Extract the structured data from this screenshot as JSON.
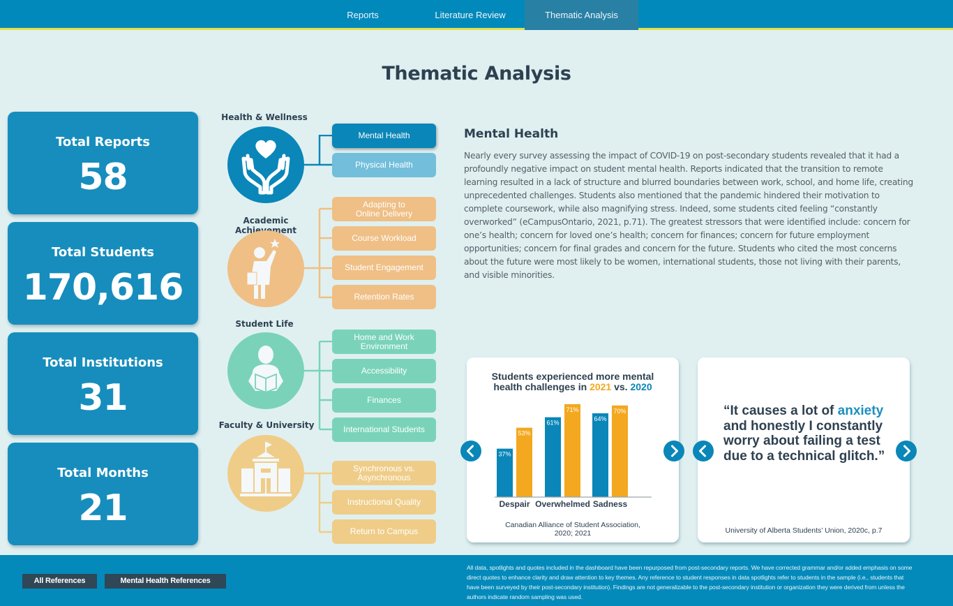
{
  "nav": {
    "tabs": [
      {
        "label": "Reports",
        "active": false
      },
      {
        "label": "Literature Review",
        "active": false
      },
      {
        "label": "Thematic Analysis",
        "active": true
      }
    ]
  },
  "page_title": "Thematic Analysis",
  "kpis": [
    {
      "label": "Total Reports",
      "value": "58"
    },
    {
      "label": "Total Students",
      "value": "170,616"
    },
    {
      "label": "Total Institutions",
      "value": "31"
    },
    {
      "label": "Total Months",
      "value": "21"
    }
  ],
  "themes": [
    {
      "title": "Health & Wellness",
      "icon": "hands-heart-icon",
      "color": "#0a86b8",
      "items": [
        {
          "label": "Mental Health",
          "selected": true
        },
        {
          "label": "Physical Health",
          "selected": false
        }
      ]
    },
    {
      "title": "Academic Achievement",
      "icon": "student-reaching-star-icon",
      "color": "#efbf85",
      "items": [
        {
          "label": "Adapting to\nOnline Delivery"
        },
        {
          "label": "Course Workload"
        },
        {
          "label": "Student Engagement"
        },
        {
          "label": "Retention Rates"
        }
      ]
    },
    {
      "title": "Student Life",
      "icon": "person-reading-icon",
      "color": "#7ad3b9",
      "items": [
        {
          "label": "Home and Work\nEnvironment"
        },
        {
          "label": "Accessibility"
        },
        {
          "label": "Finances"
        },
        {
          "label": "International Students"
        }
      ]
    },
    {
      "title": "Faculty & University",
      "icon": "university-building-icon",
      "color": "#efcd88",
      "items": [
        {
          "label": "Synchronous vs.\nAsynchronous"
        },
        {
          "label": "Instructional Quality"
        },
        {
          "label": "Return to Campus"
        }
      ]
    }
  ],
  "detail": {
    "title": "Mental Health",
    "body": "Nearly every survey assessing the impact of COVID-19 on post-secondary students revealed that it had a profoundly negative impact on student mental health. Reports indicated that the transition to remote learning resulted in a lack of structure and blurred boundaries between work, school, and home life, creating unprecedented challenges. Students also mentioned that the pandemic hindered their motivation to complete coursework, while also magnifying stress. Indeed, some students cited feeling “constantly overworked” (eCampusOntario, 2021, p.71). The greatest stressors that were identified include: concern for one’s health; concern for loved one’s health; concern for finances; concern for future employment opportunities; concern for final grades and concern for the future. Students who cited the most concerns about the future were most likely to be women, international students, those not living with their parents, and visible minorities."
  },
  "chart_card": {
    "title_line1": "Students experienced more mental",
    "title_line2_pre": "health challenges in ",
    "title_year_a": "2021",
    "title_mid": " vs. ",
    "title_year_b": "2020",
    "source_line1": "Canadian Alliance of Student Association,",
    "source_line2": "2020; 2021"
  },
  "chart_data": {
    "type": "bar",
    "title": "Students experienced more mental health challenges in 2021 vs. 2020",
    "xlabel": "",
    "ylabel": "",
    "ylim": [
      0,
      80
    ],
    "grid": false,
    "categories": [
      "Despair",
      "Overwhelmed",
      "Sadness"
    ],
    "series": [
      {
        "name": "2020",
        "color": "#0a86b8",
        "values": [
          37,
          61,
          64
        ],
        "labels": [
          "37%",
          "61%",
          "64%"
        ]
      },
      {
        "name": "2021",
        "color": "#f3a81f",
        "values": [
          53,
          71,
          70
        ],
        "labels": [
          "53%",
          "71%",
          "70%"
        ]
      }
    ]
  },
  "quote_card": {
    "quote_pre": "“It causes a lot of ",
    "quote_highlight": "anxiety",
    "quote_post": " and honestly I constantly worry about failing a test due to a technical glitch.”",
    "source": "University of Alberta Students’ Union, 2020c, p.7"
  },
  "footer": {
    "buttons": [
      "All References",
      "Mental Health References"
    ],
    "disclaimer": "All data, spotlights and quotes included in the dashboard have been repurposed from post-secondary reports. We have corrected grammar and/or added emphasis on some direct quotes to enhance clarity and draw attention to key themes. Any reference to student responses in data spotlights refer to students in the sample (i.e., students that have been surveyed by their post-secondary institution). Findings are not generalizable to the post-secondary institution or organization they were derived from unless the authors indicate random sampling was used."
  }
}
